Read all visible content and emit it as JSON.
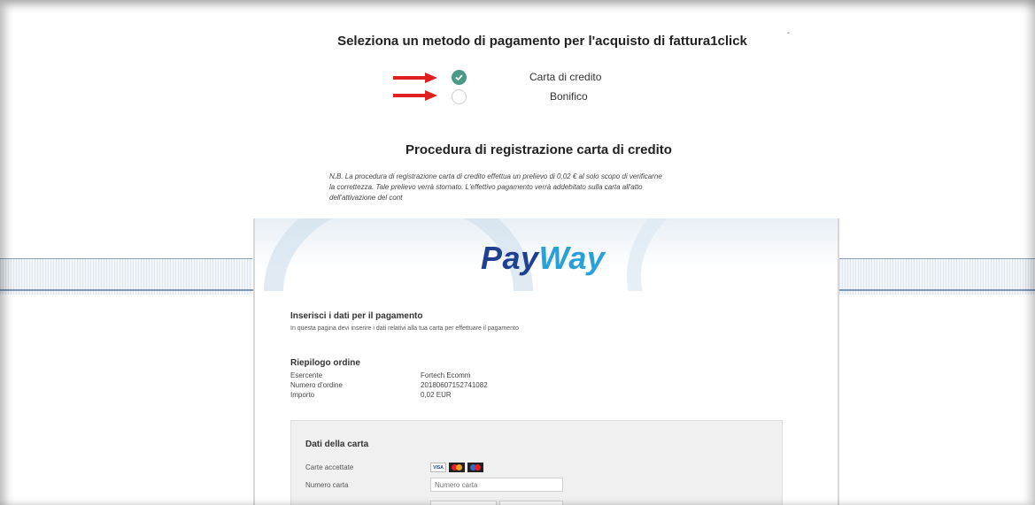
{
  "header": {
    "title": "Seleziona un metodo di pagamento per l'acquisto di fattura1click",
    "corner_mark": "-"
  },
  "payment_methods": [
    {
      "label": "Carta di credito",
      "selected": true
    },
    {
      "label": "Bonifico",
      "selected": false
    }
  ],
  "registration": {
    "title": "Procedura di registrazione carta di credito",
    "note_line1": "N.B. La procedura di registrazione carta di credito effettua un prelievo di 0,02 € al solo scopo di verificarne",
    "note_line2": "la correttezza. Tale prelievo verrà stornato. L'effettivo pagamento verrà addebitato sulla carta all'atto",
    "note_line3": "dell'attivazione del cont"
  },
  "payway": {
    "logo_pay": "Pay",
    "logo_way": "Way",
    "section_title": "Inserisci i dati per il pagamento",
    "section_subtitle": "In questa pagina devi inserire i dati relativi alla tua carta per effettuare il pagamento",
    "summary_title": "Riepilogo ordine",
    "summary": [
      {
        "key": "Esercente",
        "value": "Fortech Ecomm"
      },
      {
        "key": "Numero d'ordine",
        "value": "20180607152741082"
      },
      {
        "key": "Importo",
        "value": "0,02 EUR"
      }
    ],
    "card": {
      "title": "Dati della carta",
      "accepted_label": "Carte accettate",
      "accepted_logos": [
        "visa-logo",
        "mastercard-logo",
        "maestro-logo"
      ],
      "visa_text": "VISA",
      "number_label": "Numero carta",
      "number_placeholder": "Numero carta",
      "number_value": ""
    }
  },
  "colors": {
    "accent_check": "#4a9a87",
    "arrow_red": "#e02020",
    "payway_blue": "#1f3f8f",
    "payway_light_blue": "#2aa0d8"
  }
}
